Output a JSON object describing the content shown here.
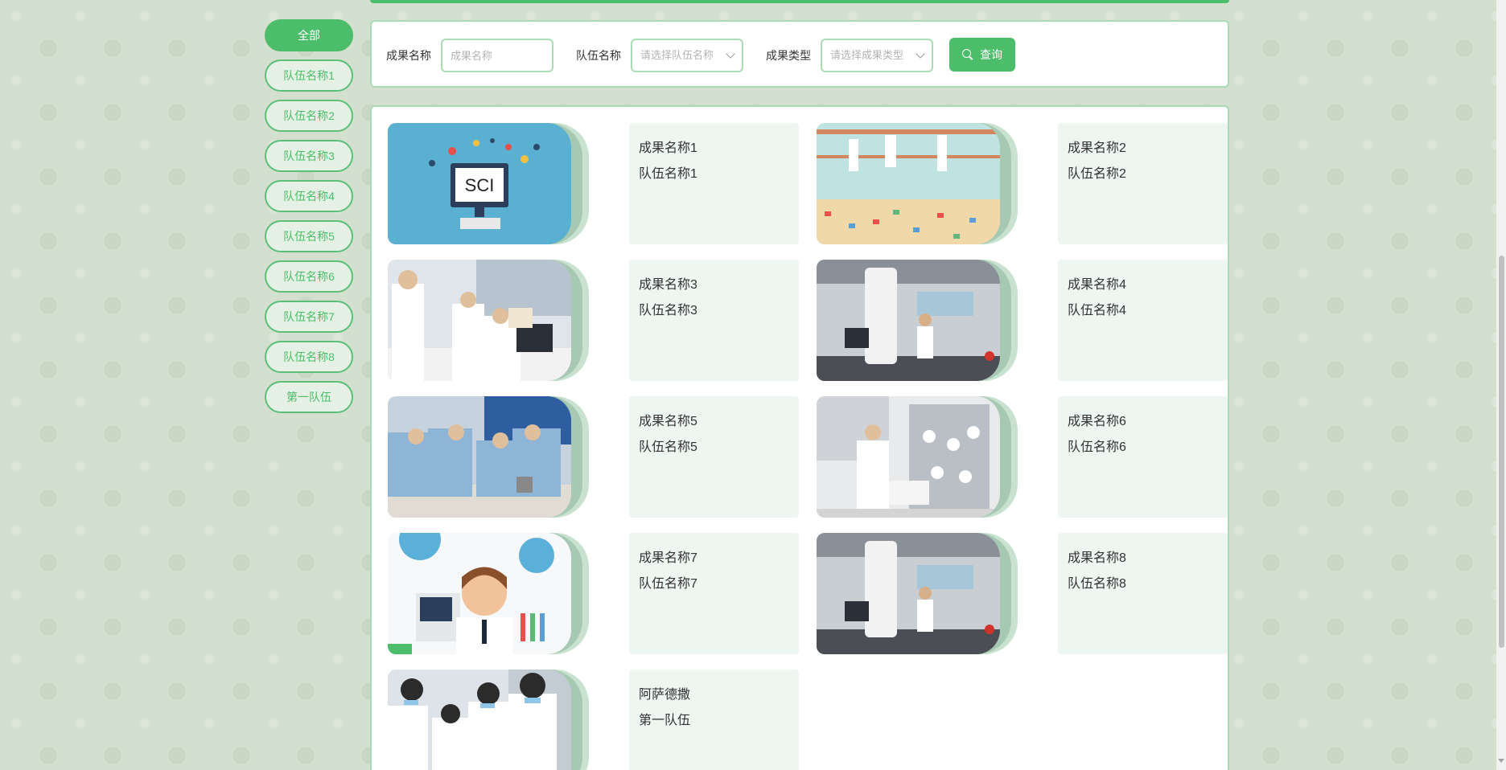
{
  "sidebar": {
    "items": [
      {
        "label": "全部"
      },
      {
        "label": "队伍名称1"
      },
      {
        "label": "队伍名称2"
      },
      {
        "label": "队伍名称3"
      },
      {
        "label": "队伍名称4"
      },
      {
        "label": "队伍名称5"
      },
      {
        "label": "队伍名称6"
      },
      {
        "label": "队伍名称7"
      },
      {
        "label": "队伍名称8"
      },
      {
        "label": "第一队伍"
      }
    ]
  },
  "search": {
    "name_label": "成果名称",
    "name_placeholder": "成果名称",
    "name_value": "",
    "team_label": "队伍名称",
    "team_placeholder": "请选择队伍名称",
    "type_label": "成果类型",
    "type_placeholder": "请选择成果类型",
    "query_label": "查询"
  },
  "results": [
    {
      "title": "成果名称1",
      "team": "队伍名称1",
      "image": "sci-illustration"
    },
    {
      "title": "成果名称2",
      "team": "队伍名称2",
      "image": "library-researchers"
    },
    {
      "title": "成果名称3",
      "team": "队伍名称3",
      "image": "lab-team-computer"
    },
    {
      "title": "成果名称4",
      "team": "队伍名称4",
      "image": "electron-microscope-lab"
    },
    {
      "title": "成果名称5",
      "team": "队伍名称5",
      "image": "cleanroom-team"
    },
    {
      "title": "成果名称6",
      "team": "队伍名称6",
      "image": "lab-glassware"
    },
    {
      "title": "成果名称7",
      "team": "队伍名称7",
      "image": "scientist-cartoon"
    },
    {
      "title": "成果名称8",
      "team": "队伍名称8",
      "image": "electron-microscope-lab"
    },
    {
      "title": "阿萨德撒",
      "team": "第一队伍",
      "image": "lab-team-group"
    }
  ],
  "colors": {
    "accent": "#4cbd6a",
    "panel_border": "#a9dbb7",
    "info_bg": "#eef6f1",
    "background": "#d3dfcf"
  },
  "icons": {
    "query": "search-icon",
    "select": "chevron-down-icon"
  }
}
